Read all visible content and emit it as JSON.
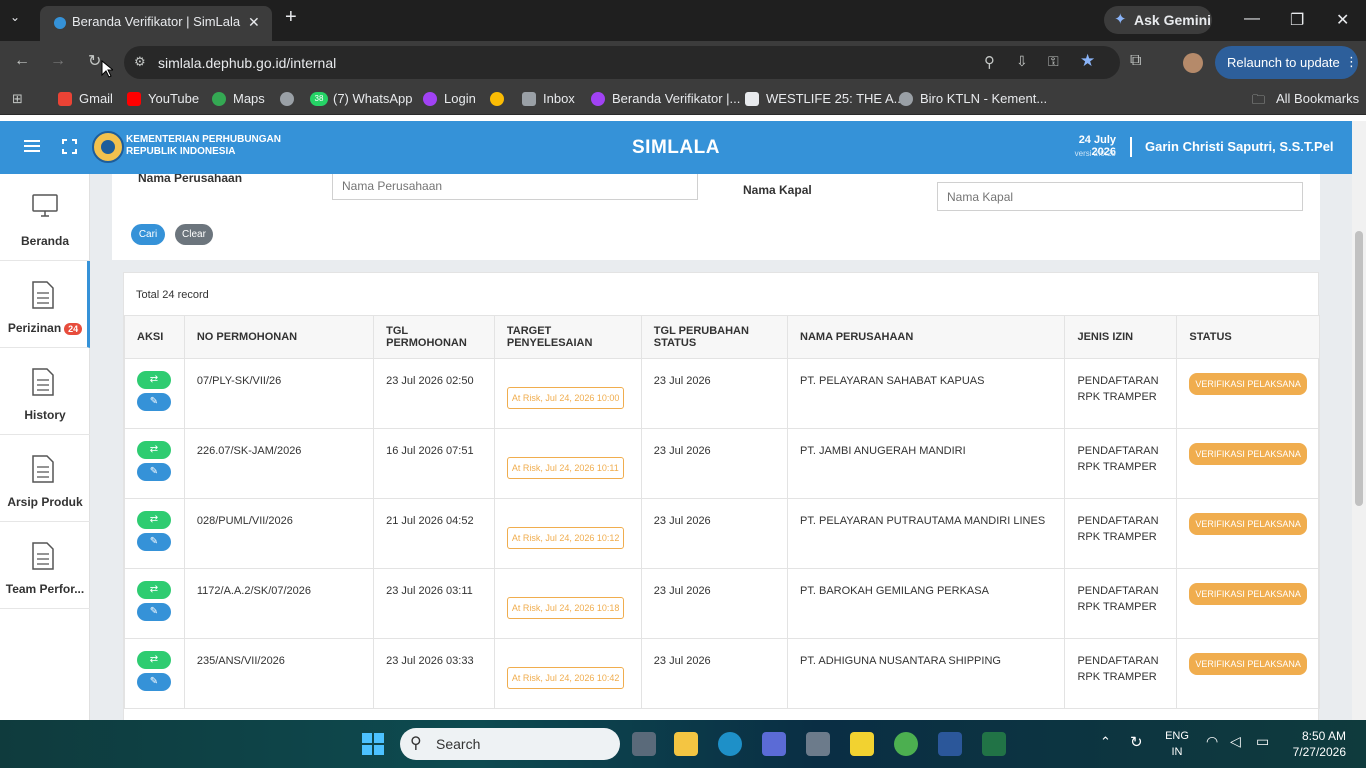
{
  "browser": {
    "tab_title": "Beranda Verifikator | SimLala",
    "url": "simlala.dephub.go.id/internal",
    "gemini_label": "Ask Gemini",
    "relaunch_label": "Relaunch to update",
    "bookmarks": [
      "Gmail",
      "YouTube",
      "Maps",
      "(7) WhatsApp",
      "Login",
      "Inbox",
      "Beranda Verifikator |...",
      "WESTLIFE 25: THE A...",
      "Biro KTLN - Kement..."
    ],
    "whatsapp_badge": "38",
    "all_bookmarks": "All Bookmarks"
  },
  "header": {
    "ministry_line1": "KEMENTERIAN PERHUBUNGAN",
    "ministry_line2": "REPUBLIK INDONESIA",
    "app_name": "SIMLALA",
    "date": "24 July 2026",
    "version": "versi 2.0.29",
    "user": "Garin Christi Saputri, S.S.T.Pel"
  },
  "sidebar": {
    "items": [
      {
        "label": "Beranda",
        "icon": "monitor-icon"
      },
      {
        "label": "Perizinan",
        "icon": "document-icon",
        "badge": "24"
      },
      {
        "label": "History",
        "icon": "document-icon"
      },
      {
        "label": "Arsip Produk",
        "icon": "document-icon"
      },
      {
        "label": "Team Perfor...",
        "icon": "document-icon"
      }
    ]
  },
  "filter": {
    "company_label": "Nama Perusahaan",
    "company_placeholder": "Nama Perusahaan",
    "ship_label": "Nama Kapal",
    "ship_placeholder": "Nama Kapal",
    "search_button": "Cari",
    "clear_button": "Clear"
  },
  "table": {
    "total": "Total 24 record",
    "headers": [
      "AKSI",
      "NO PERMOHONAN",
      "TGL PERMOHONAN",
      "TARGET PENYELESAIAN",
      "TGL PERUBAHAN STATUS",
      "NAMA PERUSAHAAN",
      "JENIS IZIN",
      "STATUS"
    ],
    "rows": [
      {
        "no": "07/PLY-SK/VII/26",
        "tgl": "23 Jul 2026 02:50",
        "target": "At Risk, Jul 24, 2026 10:00",
        "ubah": "23 Jul 2026",
        "perusahaan": "PT. PELAYARAN SAHABAT KAPUAS",
        "jenis1": "PENDAFTARAN",
        "jenis2": "RPK TRAMPER",
        "status": "VERIFIKASI PELAKSANA"
      },
      {
        "no": "226.07/SK-JAM/2026",
        "tgl": "16 Jul 2026 07:51",
        "target": "At Risk, Jul 24, 2026 10:11",
        "ubah": "23 Jul 2026",
        "perusahaan": "PT. JAMBI ANUGERAH MANDIRI",
        "jenis1": "PENDAFTARAN",
        "jenis2": "RPK TRAMPER",
        "status": "VERIFIKASI PELAKSANA"
      },
      {
        "no": "028/PUML/VII/2026",
        "tgl": "21 Jul 2026 04:52",
        "target": "At Risk, Jul 24, 2026 10:12",
        "ubah": "23 Jul 2026",
        "perusahaan": "PT. PELAYARAN PUTRAUTAMA MANDIRI LINES",
        "jenis1": "PENDAFTARAN",
        "jenis2": "RPK TRAMPER",
        "status": "VERIFIKASI PELAKSANA"
      },
      {
        "no": "1172/A.A.2/SK/07/2026",
        "tgl": "23 Jul 2026 03:11",
        "target": "At Risk, Jul 24, 2026 10:18",
        "ubah": "23 Jul 2026",
        "perusahaan": "PT. BAROKAH GEMILANG PERKASA",
        "jenis1": "PENDAFTARAN",
        "jenis2": "RPK TRAMPER",
        "status": "VERIFIKASI PELAKSANA"
      },
      {
        "no": "235/ANS/VII/2026",
        "tgl": "23 Jul 2026 03:33",
        "target": "At Risk, Jul 24, 2026 10:42",
        "ubah": "23 Jul 2026",
        "perusahaan": "PT. ADHIGUNA NUSANTARA SHIPPING",
        "jenis1": "PENDAFTARAN",
        "jenis2": "RPK TRAMPER",
        "status": "VERIFIKASI PELAKSANA"
      }
    ]
  },
  "taskbar": {
    "search": "Search",
    "lang1": "ENG",
    "lang2": "IN",
    "time": "8:50 AM",
    "date": "7/27/2026"
  },
  "colors": {
    "primary": "#3592d8",
    "success": "#2ecc71",
    "warning": "#f0ad4e",
    "badge": "#e74c3c"
  }
}
